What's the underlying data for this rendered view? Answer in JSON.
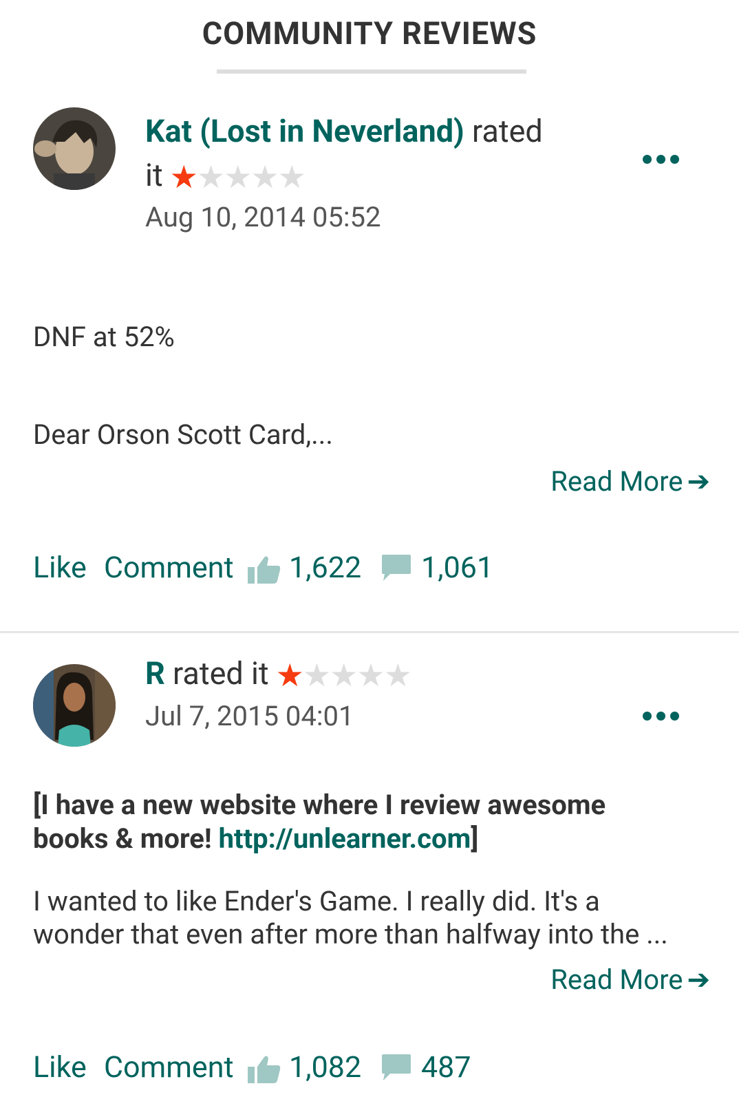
{
  "header": {
    "title": "COMMUNITY REVIEWS"
  },
  "reviews": [
    {
      "user": "Kat (Lost in Neverland)",
      "rated_word": "rated",
      "it_word": "it",
      "rating": 1,
      "max_rating": 5,
      "date": "Aug 10, 2014 05:52",
      "paragraphs": [
        "DNF at 52%",
        "Dear Orson Scott Card,..."
      ],
      "read_more": "Read More",
      "like_label": "Like",
      "comment_label": "Comment",
      "likes": "1,622",
      "comments": "1,061"
    },
    {
      "user": "R",
      "rated_it": "rated it",
      "rating": 1,
      "max_rating": 5,
      "date": "Jul 7, 2015 04:01",
      "intro_line1": "[I have a new website where I review awesome",
      "intro_line2_pre": "books & more! ",
      "intro_link": "http://unlearner.com",
      "intro_line2_post": "]",
      "body_line1": "I wanted to like Ender's Game. I really did. It's a",
      "body_line2": "wonder that even after more than halfway into the ...",
      "read_more": "Read More",
      "like_label": "Like",
      "comment_label": "Comment",
      "likes": "1,082",
      "comments": "487"
    }
  ],
  "colors": {
    "brand": "#00635d",
    "star_on": "#f53b0f",
    "star_off": "#dddddd"
  }
}
